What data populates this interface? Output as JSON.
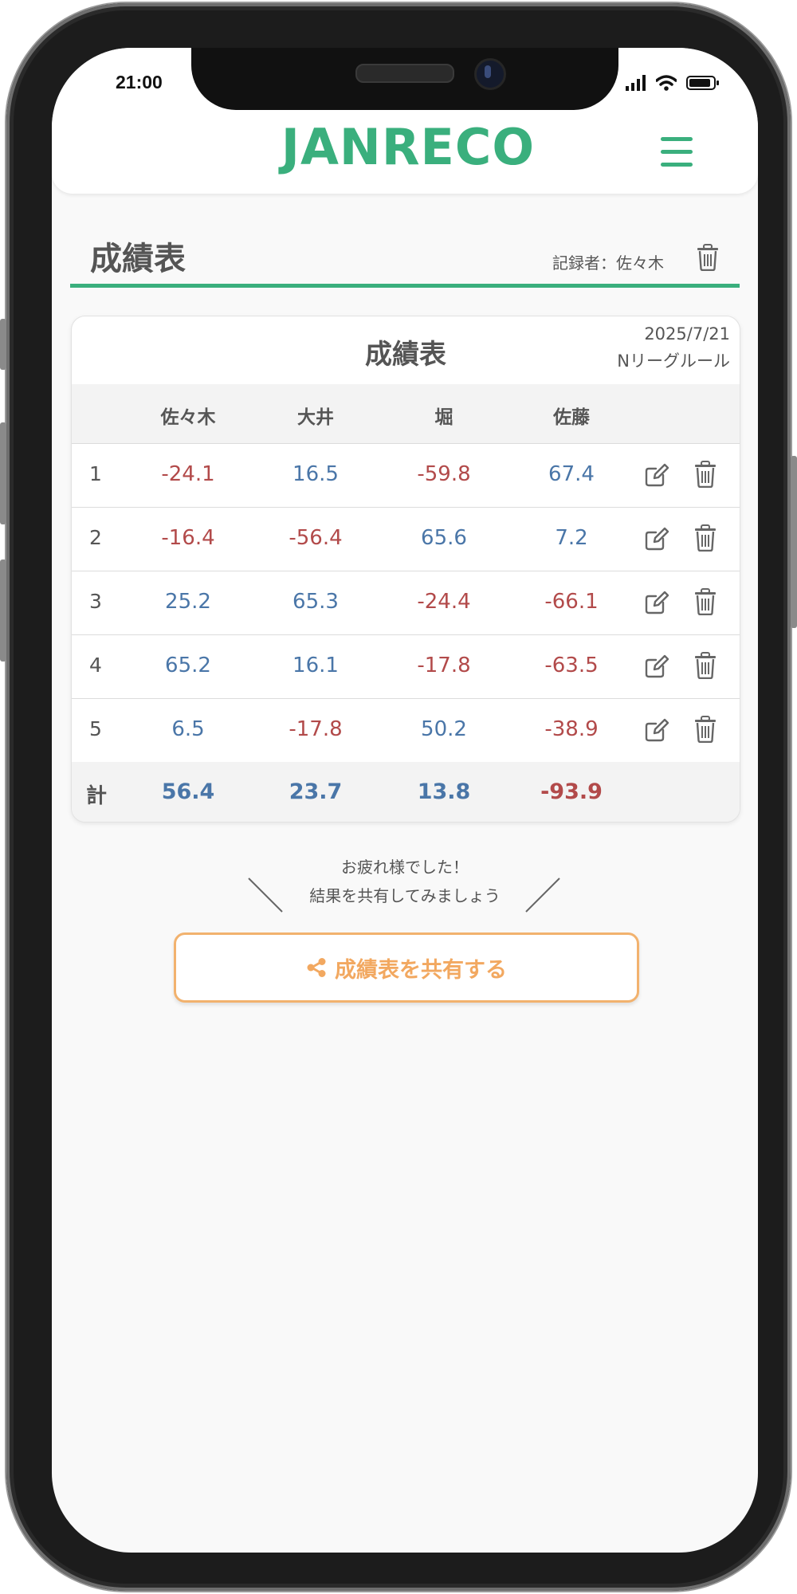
{
  "status": {
    "time": "21:00"
  },
  "header": {
    "logo": "JANRECO"
  },
  "section": {
    "title": "成績表",
    "recorder": "記録者：佐々木"
  },
  "card": {
    "title": "成績表",
    "date": "2025/7/21",
    "rule": "Nリーグルール",
    "players": [
      "佐々木",
      "大井",
      "堀",
      "佐藤"
    ],
    "rows": [
      {
        "num": "1",
        "scores": [
          "-24.1",
          "16.5",
          "-59.8",
          "67.4"
        ]
      },
      {
        "num": "2",
        "scores": [
          "-16.4",
          "-56.4",
          "65.6",
          "7.2"
        ]
      },
      {
        "num": "3",
        "scores": [
          "25.2",
          "65.3",
          "-24.4",
          "-66.1"
        ]
      },
      {
        "num": "4",
        "scores": [
          "65.2",
          "16.1",
          "-17.8",
          "-63.5"
        ]
      },
      {
        "num": "5",
        "scores": [
          "6.5",
          "-17.8",
          "50.2",
          "-38.9"
        ]
      }
    ],
    "total": {
      "label": "計",
      "scores": [
        "56.4",
        "23.7",
        "13.8",
        "-93.9"
      ]
    }
  },
  "message": {
    "line1": "お疲れ様でした！",
    "line2": "結果を共有してみましょう"
  },
  "share_button": {
    "label": "成績表を共有する"
  },
  "colors": {
    "accent": "#3aaf7d",
    "positive": "#4a76a8",
    "negative": "#b24a4a",
    "share": "#f2a860"
  },
  "icons": [
    "menu-icon",
    "trash-icon",
    "edit-icon",
    "share-icon",
    "signal-icon",
    "wifi-icon",
    "battery-icon"
  ]
}
